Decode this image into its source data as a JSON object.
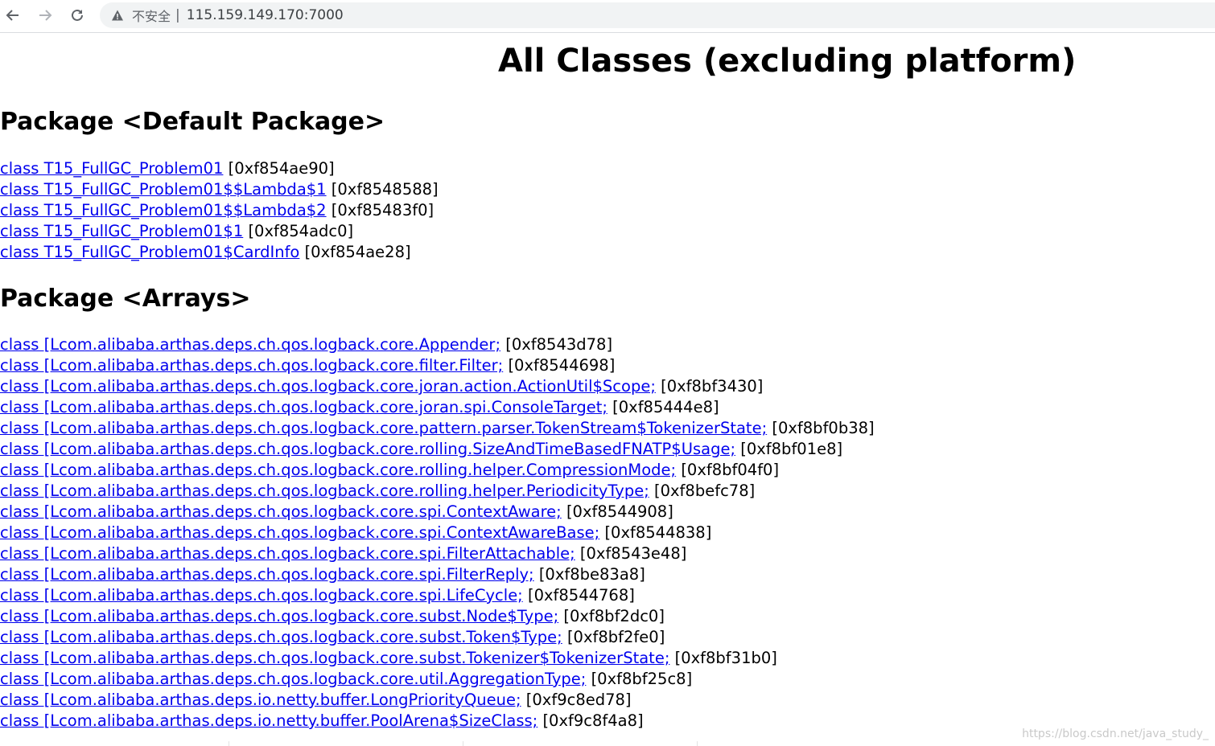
{
  "browser": {
    "insecure_label": "不安全",
    "separator": "|",
    "url": "115.159.149.170:7000"
  },
  "page": {
    "title": "All Classes (excluding platform)",
    "packages": [
      {
        "heading": "Package <Default Package>",
        "classes": [
          {
            "name": "class T15_FullGC_Problem01",
            "address": "[0xf854ae90]"
          },
          {
            "name": "class T15_FullGC_Problem01$$Lambda$1",
            "address": "[0xf8548588]"
          },
          {
            "name": "class T15_FullGC_Problem01$$Lambda$2",
            "address": "[0xf85483f0]"
          },
          {
            "name": "class T15_FullGC_Problem01$1",
            "address": "[0xf854adc0]"
          },
          {
            "name": "class T15_FullGC_Problem01$CardInfo",
            "address": "[0xf854ae28]"
          }
        ]
      },
      {
        "heading": "Package <Arrays>",
        "classes": [
          {
            "name": "class [Lcom.alibaba.arthas.deps.ch.qos.logback.core.Appender;",
            "address": "[0xf8543d78]"
          },
          {
            "name": "class [Lcom.alibaba.arthas.deps.ch.qos.logback.core.filter.Filter;",
            "address": "[0xf8544698]"
          },
          {
            "name": "class [Lcom.alibaba.arthas.deps.ch.qos.logback.core.joran.action.ActionUtil$Scope;",
            "address": "[0xf8bf3430]"
          },
          {
            "name": "class [Lcom.alibaba.arthas.deps.ch.qos.logback.core.joran.spi.ConsoleTarget;",
            "address": "[0xf85444e8]"
          },
          {
            "name": "class [Lcom.alibaba.arthas.deps.ch.qos.logback.core.pattern.parser.TokenStream$TokenizerState;",
            "address": "[0xf8bf0b38]"
          },
          {
            "name": "class [Lcom.alibaba.arthas.deps.ch.qos.logback.core.rolling.SizeAndTimeBasedFNATP$Usage;",
            "address": "[0xf8bf01e8]"
          },
          {
            "name": "class [Lcom.alibaba.arthas.deps.ch.qos.logback.core.rolling.helper.CompressionMode;",
            "address": "[0xf8bf04f0]"
          },
          {
            "name": "class [Lcom.alibaba.arthas.deps.ch.qos.logback.core.rolling.helper.PeriodicityType;",
            "address": "[0xf8befc78]"
          },
          {
            "name": "class [Lcom.alibaba.arthas.deps.ch.qos.logback.core.spi.ContextAware;",
            "address": "[0xf8544908]"
          },
          {
            "name": "class [Lcom.alibaba.arthas.deps.ch.qos.logback.core.spi.ContextAwareBase;",
            "address": "[0xf8544838]"
          },
          {
            "name": "class [Lcom.alibaba.arthas.deps.ch.qos.logback.core.spi.FilterAttachable;",
            "address": "[0xf8543e48]"
          },
          {
            "name": "class [Lcom.alibaba.arthas.deps.ch.qos.logback.core.spi.FilterReply;",
            "address": "[0xf8be83a8]"
          },
          {
            "name": "class [Lcom.alibaba.arthas.deps.ch.qos.logback.core.spi.LifeCycle;",
            "address": "[0xf8544768]"
          },
          {
            "name": "class [Lcom.alibaba.arthas.deps.ch.qos.logback.core.subst.Node$Type;",
            "address": "[0xf8bf2dc0]"
          },
          {
            "name": "class [Lcom.alibaba.arthas.deps.ch.qos.logback.core.subst.Token$Type;",
            "address": "[0xf8bf2fe0]"
          },
          {
            "name": "class [Lcom.alibaba.arthas.deps.ch.qos.logback.core.subst.Tokenizer$TokenizerState;",
            "address": "[0xf8bf31b0]"
          },
          {
            "name": "class [Lcom.alibaba.arthas.deps.ch.qos.logback.core.util.AggregationType;",
            "address": "[0xf8bf25c8]"
          },
          {
            "name": "class [Lcom.alibaba.arthas.deps.io.netty.buffer.LongPriorityQueue;",
            "address": "[0xf9c8ed78]"
          },
          {
            "name": "class [Lcom.alibaba.arthas.deps.io.netty.buffer.PoolArena$SizeClass;",
            "address": "[0xf9c8f4a8]"
          }
        ]
      }
    ]
  },
  "watermark": "https://blog.csdn.net/java_study_",
  "colors": {
    "link": "#0000ee",
    "text": "#000000",
    "omnibox_bg": "#f1f3f4"
  },
  "icons": [
    "back-arrow-icon",
    "forward-arrow-icon",
    "reload-icon",
    "warning-icon"
  ]
}
